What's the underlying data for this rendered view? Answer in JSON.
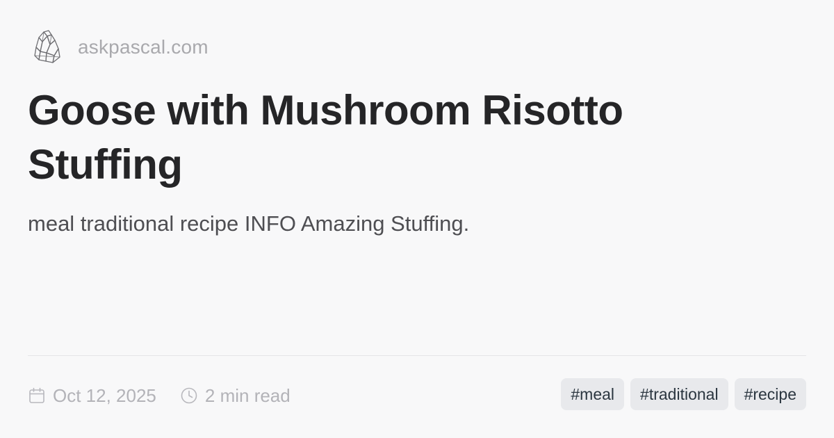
{
  "site": {
    "domain": "askpascal.com",
    "logo_icon": "crystal-icon"
  },
  "article": {
    "title": "Goose with Mushroom Risotto Stuffing",
    "description": "meal traditional recipe INFO Amazing Stuffing."
  },
  "meta": {
    "date": "Oct 12, 2025",
    "date_icon": "calendar-icon",
    "read_time": "2 min read",
    "read_time_icon": "clock-icon"
  },
  "tags": [
    "#meal",
    "#traditional",
    "#recipe"
  ]
}
